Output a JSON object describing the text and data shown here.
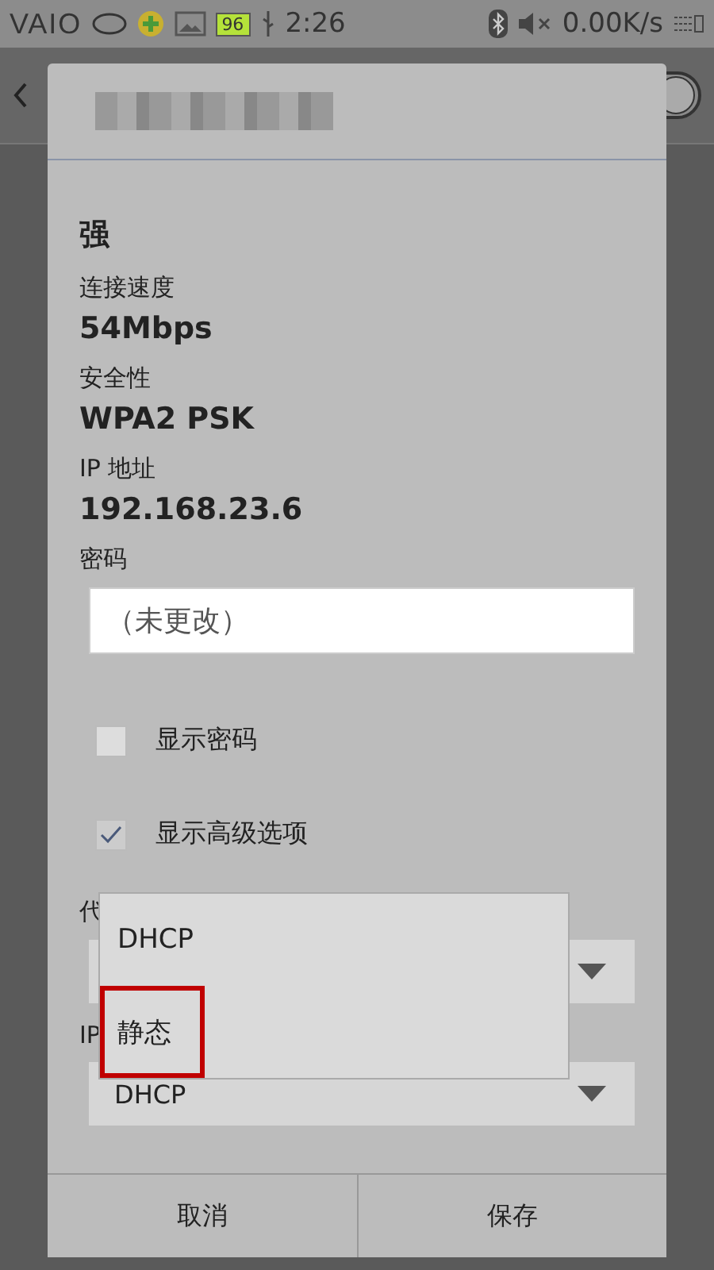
{
  "status_bar": {
    "logo": "VAIO",
    "battery": "96",
    "time": "2:26",
    "speed": "0.00K/s"
  },
  "wlan_toggle": {
    "on": true
  },
  "dialog": {
    "signal_value": "强",
    "fields": [
      {
        "label": "连接速度",
        "value": "54Mbps"
      },
      {
        "label": "安全性",
        "value": "WPA2 PSK"
      },
      {
        "label": "IP 地址",
        "value": "192.168.23.6"
      }
    ],
    "password": {
      "label": "密码",
      "placeholder": "（未更改）"
    },
    "checkboxes": [
      {
        "label": "显示密码",
        "checked": false
      },
      {
        "label": "显示高级选项",
        "checked": true
      }
    ],
    "proxy": {
      "label": "代"
    },
    "ip_settings": {
      "label": "IP",
      "value": "DHCP"
    },
    "buttons": [
      {
        "label": "取消"
      },
      {
        "label": "保存"
      }
    ]
  },
  "popup_menu": [
    {
      "label": "DHCP",
      "highlighted": false
    },
    {
      "label": "静态",
      "highlighted": true
    }
  ]
}
